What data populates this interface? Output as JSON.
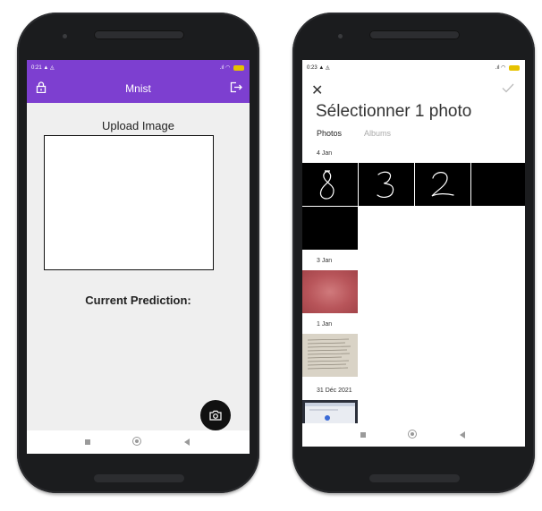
{
  "left_phone": {
    "status_time": "0:21",
    "status_extra": "▲ ◬",
    "app_title": "Mnist",
    "upload_title": "Upload Image",
    "prediction_label": "Current Prediction:"
  },
  "right_phone": {
    "status_time": "0:23",
    "status_extra": "▲ ◬",
    "picker_title": "Sélectionner 1 photo",
    "tabs": [
      "Photos",
      "Albums"
    ],
    "dates": [
      "4 Jan",
      "3 Jan",
      "1 Jan",
      "31 Déc 2021"
    ],
    "digits": [
      "8",
      "3",
      "2"
    ]
  },
  "colors": {
    "accent": "#7d3fd0",
    "fab": "#111111",
    "battery": "#e6c200"
  }
}
